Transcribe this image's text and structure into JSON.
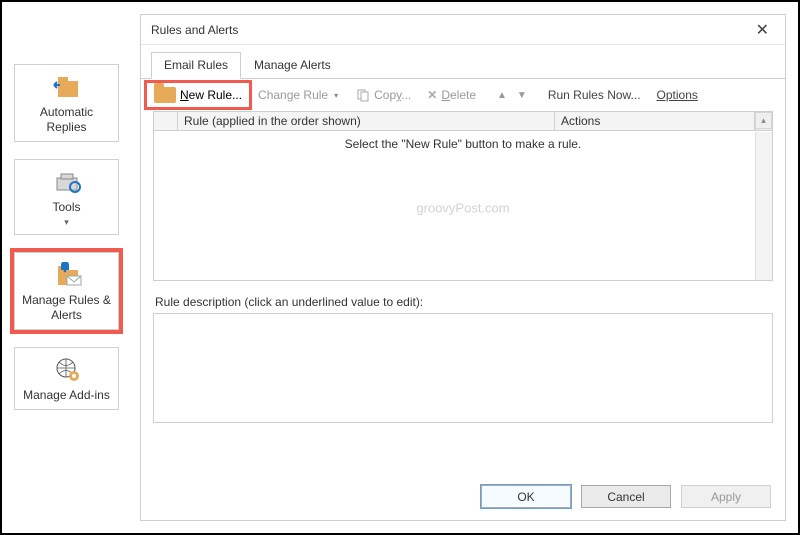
{
  "sidebar": {
    "automatic_replies": "Automatic Replies",
    "tools": "Tools",
    "manage_rules": "Manage Rules & Alerts",
    "manage_addins": "Manage Add-ins"
  },
  "dialog": {
    "title": "Rules and Alerts",
    "tabs": {
      "email_rules": "Email Rules",
      "manage_alerts": "Manage Alerts"
    },
    "toolbar": {
      "new_rule": "New Rule...",
      "change_rule": "Change Rule",
      "copy": "Copy...",
      "delete": "Delete",
      "run_rules_now": "Run Rules Now...",
      "options": "Options"
    },
    "list": {
      "col_rule": "Rule (applied in the order shown)",
      "col_actions": "Actions",
      "empty_hint": "Select the \"New Rule\" button to make a rule."
    },
    "watermark": "groovyPost.com",
    "description_label": "Rule description (click an underlined value to edit):",
    "buttons": {
      "ok": "OK",
      "cancel": "Cancel",
      "apply": "Apply"
    }
  }
}
